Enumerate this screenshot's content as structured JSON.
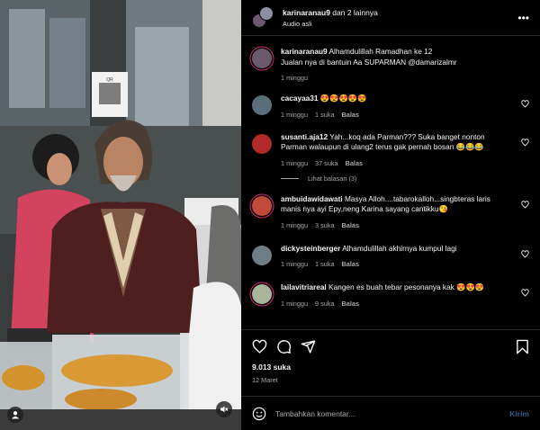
{
  "header": {
    "username": "karinaranau9",
    "collab_suffix": " dan 2 lainnya",
    "audio": "Audio asli",
    "more_icon": "more-horizontal-icon"
  },
  "media": {
    "sign_text": "QR",
    "user_icon": "user-icon",
    "mute_icon": "speaker-muted-icon"
  },
  "caption": {
    "username": "karinaranau9",
    "line1": " Alhamdulillah Ramadhan ke 12",
    "line2": "Jualan nya di bantuin Aa SUPARMAN @damarizalmr",
    "time": "1 minggu"
  },
  "comments": [
    {
      "username": "cacayaa31",
      "text": " 😍😍😍😍😍",
      "time": "1 minggu",
      "likes": "1 suka",
      "reply": "Balas",
      "avatar_color": "#5a6e7a"
    },
    {
      "username": "susanti.aja12",
      "text": " Yah...koq ada Parman??? Suka banget nonton Parman walaupun di ulang2 terus gak pernah bosan 😂😂😂",
      "time": "1 minggu",
      "likes": "37 suka",
      "reply": "Balas",
      "avatar_color": "#b02a2a",
      "view_replies": "Lihat balasan (3)"
    },
    {
      "username": "ambuidawidawati",
      "text": " Masya Alloh....tabarokalloh...singbteras laris manis nya ayi Epy,neng Karina sayang cantikku😘",
      "time": "1 minggu",
      "likes": "3 suka",
      "reply": "Balas",
      "avatar_color": "#c24a3a"
    },
    {
      "username": "dickysteinberger",
      "text": " Alhamdulillah akhirnya kumpul lagi",
      "time": "1 minggu",
      "likes": "1 suka",
      "reply": "Balas",
      "avatar_color": "#6e7e86"
    },
    {
      "username": "lailavitriareal",
      "text": " Kangen es buah tebar pesonanya kak 😍😍😍",
      "time": "1 minggu",
      "likes": "9 suka",
      "reply": "Balas",
      "avatar_color": "#a9b59a"
    }
  ],
  "actions": {
    "likes_count": "9.013 suka",
    "date": "12 Maret"
  },
  "add_comment": {
    "placeholder": "Tambahkan komentar...",
    "post_label": "Kirim"
  },
  "colors": {
    "background": "#000000",
    "text": "#f5f5f5",
    "secondary_text": "#a8a8a8",
    "divider": "#262626",
    "post_button": "#2d5b87",
    "story_ring": "#d62976"
  }
}
